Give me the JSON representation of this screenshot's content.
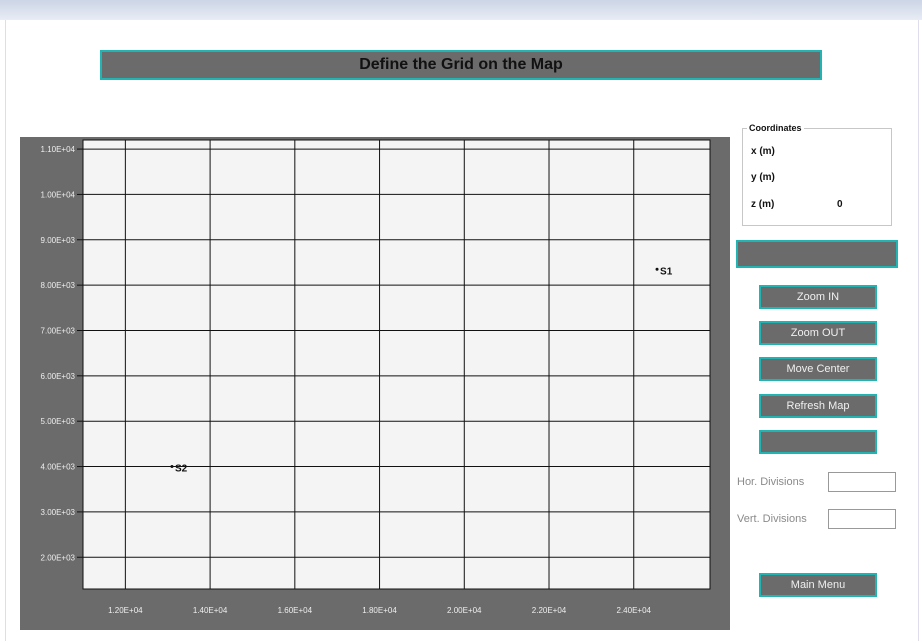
{
  "title": "Define the Grid on the Map",
  "colors": {
    "panel_gray": "#6b6b6b",
    "accent_teal": "#22b3b3",
    "plot_bg": "#f4f4f4"
  },
  "coordinates": {
    "legend": "Coordinates",
    "x_label": "x (m)",
    "y_label": "y (m)",
    "z_label": "z (m)",
    "z_value": "0"
  },
  "buttons": {
    "zoom_in": "Zoom IN",
    "zoom_out": "Zoom OUT",
    "move_center": "Move Center",
    "refresh_map": "Refresh Map",
    "main_menu": "Main Menu"
  },
  "divisions": {
    "horizontal_label": "Hor. Divisions",
    "horizontal_value": "",
    "vertical_label": "Vert. Divisions",
    "vertical_value": ""
  },
  "map": {
    "x_range": [
      11000,
      25800
    ],
    "y_range": [
      1300,
      11200
    ],
    "x_ticks": [
      12000,
      14000,
      16000,
      18000,
      20000,
      22000,
      24000
    ],
    "x_tick_labels": [
      "1.20E+04",
      "1.40E+04",
      "1.60E+04",
      "1.80E+04",
      "2.00E+04",
      "2.20E+04",
      "2.40E+04"
    ],
    "y_ticks": [
      2000,
      3000,
      4000,
      5000,
      6000,
      7000,
      8000,
      9000,
      10000,
      11000
    ],
    "y_tick_labels": [
      "2.00E+03",
      "3.00E+03",
      "4.00E+03",
      "5.00E+03",
      "6.00E+03",
      "7.00E+03",
      "8.00E+03",
      "9.00E+03",
      "1.00E+04",
      "1.10E+04"
    ],
    "points": [
      {
        "label": "S1",
        "x": 24550,
        "y": 8350
      },
      {
        "label": "S2",
        "x": 13100,
        "y": 4000
      }
    ]
  }
}
